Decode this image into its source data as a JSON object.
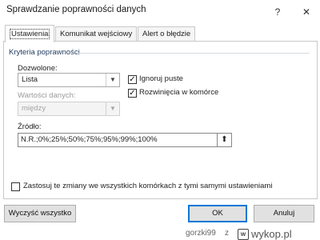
{
  "window": {
    "title": "Sprawdzanie poprawności danych",
    "help_glyph": "?",
    "close_glyph": "✕"
  },
  "tabs": [
    "Ustawienia",
    "Komunikat wejściowy",
    "Alert o błędzie"
  ],
  "criteria": {
    "group_label": "Kryteria poprawności",
    "allow_label": "Dozwolone:",
    "allow_value": "Lista",
    "data_label": "Wartości danych:",
    "data_value": "między",
    "ignore_blank_label": "Ignoruj puste",
    "ignore_blank_checked": true,
    "in_cell_dropdown_label": "Rozwinięcia w komórce",
    "in_cell_dropdown_checked": true,
    "source_label": "Źródło:",
    "source_value": "N.R.;0%;25%;50%;75%;95%;99%;100%"
  },
  "apply_all_label": "Zastosuj te zmiany we wszystkich komórkach z tymi samymi ustawieniami",
  "apply_all_checked": false,
  "buttons": {
    "clear_all": "Wyczyść wszystko",
    "ok": "OK",
    "cancel": "Anuluj"
  },
  "watermark": {
    "user": "gorzki99",
    "separator": "z",
    "site": "wykop.pl"
  },
  "icons": {
    "dropdown": "chevron-down-icon",
    "range_picker": "range-picker-icon",
    "check": "checkmark-icon"
  }
}
